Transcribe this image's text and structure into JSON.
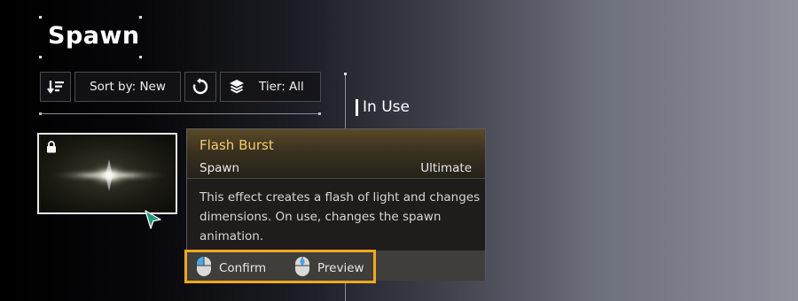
{
  "header": {
    "title": "Spawn"
  },
  "toolbar": {
    "sort_icon": "sort-icon",
    "sort_label": "Sort by: New",
    "refresh_icon": "refresh-icon",
    "layers_icon": "layers-icon",
    "tier_label": "Tier: All"
  },
  "in_use": {
    "label": "In Use"
  },
  "item": {
    "lock_icon": "lock-icon"
  },
  "tooltip": {
    "name": "Flash Burst",
    "category": "Spawn",
    "tier": "Ultimate",
    "description": "This effect creates a flash of light and changes dimensions. On use, changes the spawn animation.",
    "confirm_label": "Confirm",
    "preview_label": "Preview"
  },
  "colors": {
    "accent": "#f0a722",
    "item_name": "#f1cd6c"
  }
}
